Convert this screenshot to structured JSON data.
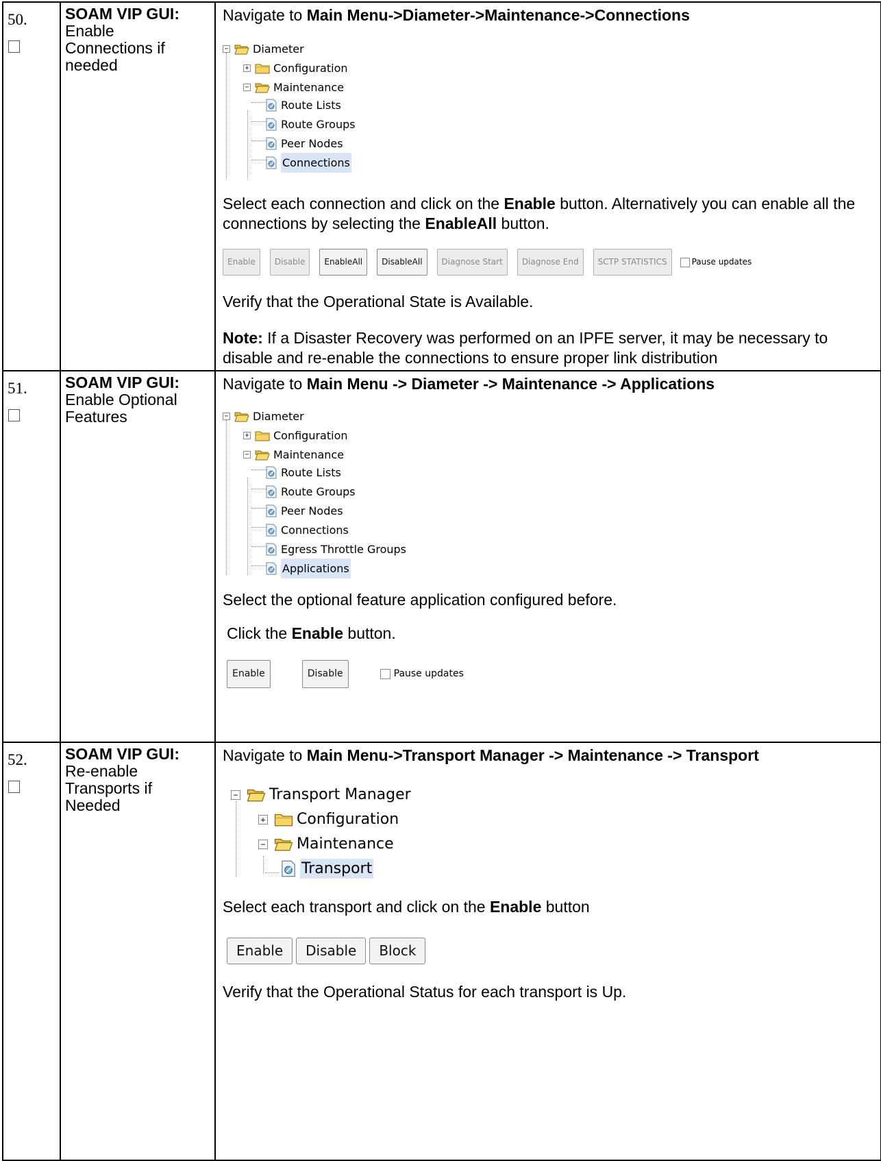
{
  "steps": [
    {
      "number": "50.",
      "title_bold": "SOAM VIP GUI:",
      "title_rest_1": "Enable",
      "title_rest_2": "Connections if",
      "title_rest_3": "needed",
      "nav_prefix": "Navigate to ",
      "nav_path": "Main Menu->Diameter->Maintenance->Connections",
      "tree": [
        "Diameter",
        "Configuration",
        "Maintenance",
        "Route Lists",
        "Route Groups",
        "Peer Nodes",
        "Connections"
      ],
      "instr_a": "Select each connection and click on the ",
      "instr_b": "Enable",
      "instr_c": " button. Alternatively you can enable all the connections by selecting the ",
      "instr_d": "EnableAll",
      "instr_e": " button.",
      "buttons": [
        "Enable",
        "Disable",
        "EnableAll",
        "DisableAll",
        "Diagnose Start",
        "Diagnose End",
        "SCTP STATISTICS"
      ],
      "pause_label": "Pause updates",
      "verify": "Verify that the Operational State is Available.",
      "note_label": "Note:",
      "note_text": " If a Disaster Recovery was performed on an IPFE server, it may be necessary to disable and re-enable the connections to ensure proper link distribution"
    },
    {
      "number": "51.",
      "title_bold": "SOAM VIP GUI:",
      "title_rest_1": "Enable Optional",
      "title_rest_2": "Features",
      "nav_prefix": "Navigate to ",
      "nav_path": "Main Menu -> Diameter -> Maintenance -> Applications",
      "tree": [
        "Diameter",
        "Configuration",
        "Maintenance",
        "Route Lists",
        "Route Groups",
        "Peer Nodes",
        "Connections",
        "Egress Throttle Groups",
        "Applications"
      ],
      "select_text": "Select the optional feature application configured before.",
      "click_a": "Click the ",
      "click_b": "Enable",
      "click_c": " button.",
      "buttons": [
        "Enable",
        "Disable"
      ],
      "pause_label": "Pause updates"
    },
    {
      "number": "52.",
      "title_bold": "SOAM VIP GUI:",
      "title_rest_1": "Re-enable",
      "title_rest_2": "Transports if",
      "title_rest_3": "Needed",
      "nav_prefix": "Navigate to ",
      "nav_path": "Main Menu->Transport Manager -> Maintenance -> Transport",
      "tree": [
        "Transport Manager",
        "Configuration",
        "Maintenance",
        "Transport"
      ],
      "instr_a": "Select each transport and click on the ",
      "instr_b": "Enable",
      "instr_c": " button",
      "buttons": [
        "Enable",
        "Disable",
        "Block"
      ],
      "verify": "Verify that the Operational Status for each transport is Up."
    }
  ]
}
